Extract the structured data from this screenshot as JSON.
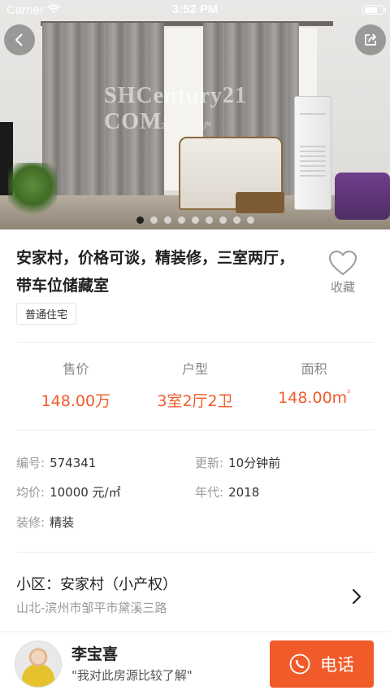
{
  "status_bar": {
    "carrier": "Carrier",
    "time": "3:52 PM",
    "battery_level": 0.75
  },
  "hero": {
    "watermark": "SHCentury21 COM",
    "watermark_sub": "21世纪不动产",
    "slide_count": 9,
    "active_slide": 0
  },
  "icons": {
    "back": "chevron-left-icon",
    "share": "share-icon",
    "favorite": "heart-icon",
    "chevron": "chevron-right-icon",
    "phone": "phone-icon"
  },
  "listing": {
    "title": "安家村，价格可谈，精装修，三室两厅，带车位储藏室",
    "tag": "普通住宅",
    "favorite_label": "收藏"
  },
  "stats": [
    {
      "label": "售价",
      "value": "148.00万"
    },
    {
      "label": "户型",
      "value": "3室2厅2卫"
    },
    {
      "label": "面积",
      "value": "148.00m",
      "unit_sup": "²"
    }
  ],
  "details": {
    "id_label": "编号:",
    "id_value": "574341",
    "updated_label": "更新:",
    "updated_value": "10分钟前",
    "unit_price_label": "均价:",
    "unit_price_value": "10000 元/㎡",
    "year_label": "年代:",
    "year_value": "2018",
    "decoration_label": "装修:",
    "decoration_value": "精装"
  },
  "community": {
    "name": "小区：安家村（小产权）",
    "address": "山北-滨州市邹平市黛溪三路"
  },
  "agent": {
    "name": "李宝喜",
    "quote": "\"我对此房源比较了解\"",
    "call_label": "电话"
  },
  "colors": {
    "accent": "#f15b2a",
    "muted_text": "#999999"
  }
}
